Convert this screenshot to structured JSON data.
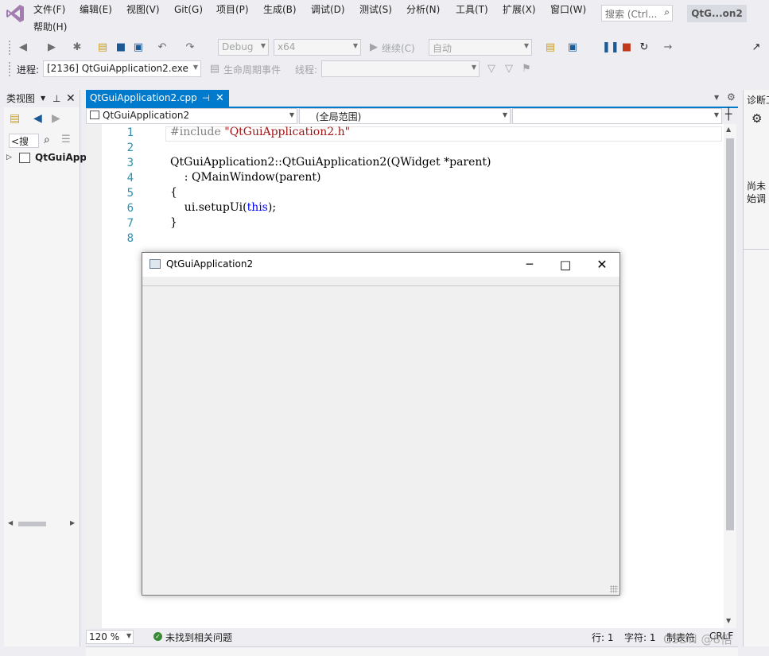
{
  "menu": {
    "items": [
      "文件(F)",
      "编辑(E)",
      "视图(V)",
      "Git(G)",
      "项目(P)",
      "生成(B)",
      "调试(D)",
      "测试(S)",
      "分析(N)",
      "工具(T)",
      "扩展(X)",
      "窗口(W)"
    ],
    "help": "帮助(H)",
    "search_placeholder": "搜索 (Ctrl...",
    "solution_name": "QtG...on2"
  },
  "toolbar": {
    "config": "Debug",
    "platform": "x64",
    "continue_label": "继续(C)",
    "auto_label": "自动",
    "process_label": "进程:",
    "process_value": "[2136] QtGuiApplication2.exe",
    "lifecycle_label": "生命周期事件",
    "thread_label": "线程:"
  },
  "classview": {
    "title": "类视图",
    "search_placeholder": "<搜",
    "tree_item": "QtGuiApp"
  },
  "editor": {
    "tab_title": "QtGuiApplication2.cpp",
    "nav_project": "QtGuiApplication2",
    "nav_scope": "(全局范围)",
    "line_numbers": [
      "1",
      "2",
      "3",
      "4",
      "5",
      "6",
      "7",
      "8"
    ],
    "code": {
      "l1_directive": "#include ",
      "l1_string": "\"QtGuiApplication2.h\"",
      "l3": "QtGuiApplication2::QtGuiApplication2(QWidget *parent)",
      "l4": "    : QMainWindow(parent)",
      "l5": "{",
      "l6_pre": "    ui.setupUi(",
      "l6_kw": "this",
      "l6_post": ");",
      "l7": "}"
    }
  },
  "diagnostics": {
    "title": "诊断工",
    "text1": "尚未",
    "text2": "始调"
  },
  "status": {
    "zoom": "120 %",
    "issues": "未找到相关问题",
    "line": "行: 1",
    "char": "字符: 1",
    "tab": "制表符",
    "eol": "CRLF",
    "watermark": "CSDN @8倍"
  },
  "qt_window": {
    "title": "QtGuiApplication2"
  },
  "colors": {
    "accent": "#007acc",
    "keyword": "#0000ff",
    "string": "#a31515",
    "line_number": "#2b91af"
  }
}
